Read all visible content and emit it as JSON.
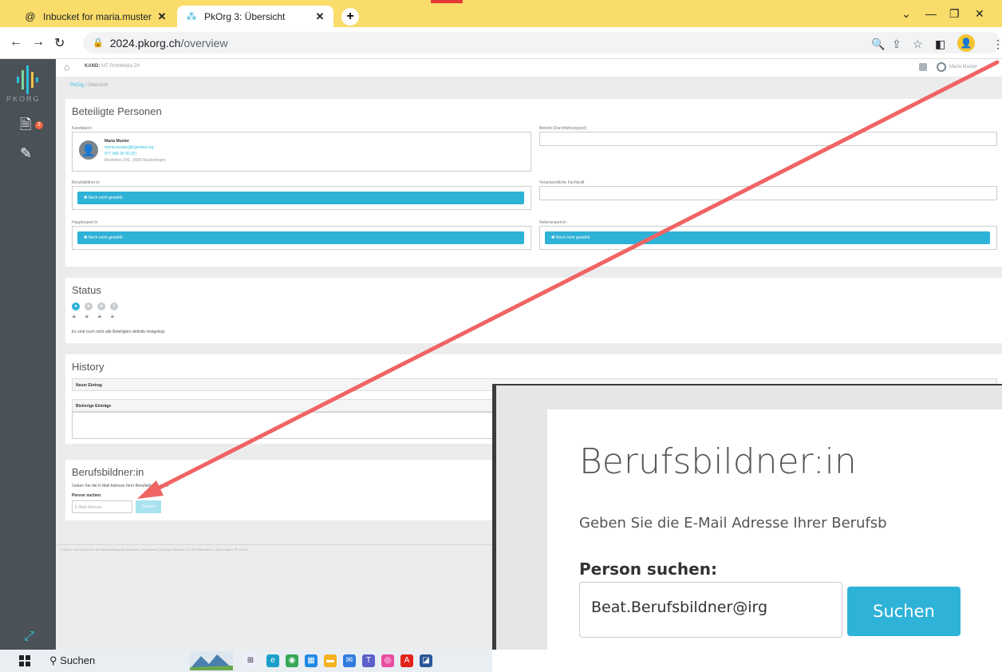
{
  "browser": {
    "tabs": [
      {
        "title": "Inbucket for maria.muster",
        "favicon": "at-icon"
      },
      {
        "title": "PkOrg 3: Übersicht",
        "favicon": "pkorg-icon"
      }
    ],
    "url_host": "2024.pkorg.ch",
    "url_path": "/overview"
  },
  "sidebar": {
    "logo_text": "PKORG",
    "badge": "3"
  },
  "header": {
    "kand_label": "KAND:",
    "kand_value": "MT PrintMedia ZH",
    "user_name": "Maria Muster"
  },
  "breadcrumb": {
    "root": "PkOrg",
    "sep": "/",
    "current": "Übersicht"
  },
  "beteiligte": {
    "title": "Beteiligte Personen",
    "kandidat_label": "Kandidat:in",
    "kandidat": {
      "name": "Maria Muster",
      "email": "maria.muster@irgendwo.eg",
      "phone": "077 000 00 00 (P)",
      "address": "Musterlex 200 , 0000 Musterlingen"
    },
    "betrieb_label": "Betrieb (Durchführungsort)",
    "berufsbildner_label": "Berufsbildner:in",
    "fachkraft_label": "Verantwortliche Fachkraft",
    "hauptexpert_label": "Hauptexpert:in",
    "nebenexpert_label": "Nebenexpert:in",
    "not_selected": "Noch nicht gewählt"
  },
  "status": {
    "title": "Status",
    "text": "Es sind noch nicht alle Beteiligten definitiv festgelegt."
  },
  "history": {
    "title": "History",
    "new_entry": "Neuer Eintrag",
    "past_entries": "Bisherige Einträge"
  },
  "berufsbildner_section": {
    "title": "Berufsbildner:in",
    "text_small": "Geben Sie die E-Mail Adresse Ihrer Berufsbildner:in an.",
    "person_label": "Person suchen:",
    "placeholder": "E-Mail-Adresse",
    "button": "Suchen"
  },
  "footer": {
    "text": "© 2023 - ein Produkt für die Berufsbildung der kandi AG | Impressum | PkOrg 3 Version 3.11.28 b7f6ea401b | 2024 Hosts | ⚙ 01:30 h"
  },
  "zoom": {
    "title": "Berufsbildner:in",
    "text": "Geben Sie die E-Mail Adresse Ihrer Berufsb",
    "person_label": "Person suchen:",
    "input_value": "Beat.Berufsbildner@irg",
    "button": "Suchen"
  },
  "taskbar": {
    "search_label": "Suchen"
  },
  "colors": {
    "accent": "#2fb2d7",
    "tabbar": "#f9dc6a",
    "sidebar": "#4a5157",
    "arrow": "#f06464"
  }
}
